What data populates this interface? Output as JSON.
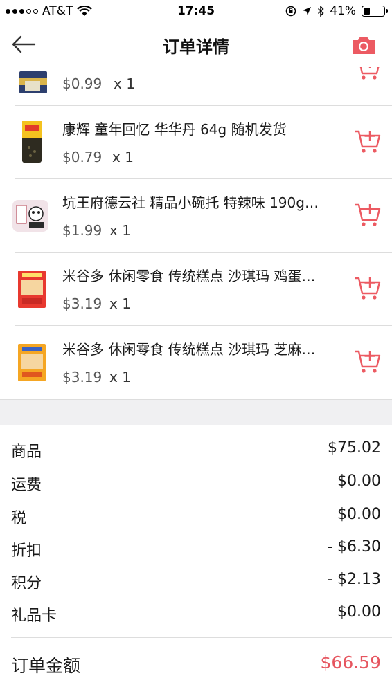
{
  "status_bar": {
    "carrier": "AT&T",
    "time": "17:45",
    "battery": "41%",
    "battery_level": 0.41
  },
  "nav": {
    "title": "订单详情",
    "back_icon": "arrow-left-icon",
    "camera_icon": "camera-icon"
  },
  "items": [
    {
      "name": "",
      "price": "$0.99",
      "qty": "x 1"
    },
    {
      "name": "康辉 童年回忆 华华丹 64g 随机发货",
      "price": "$0.79",
      "qty": "x 1"
    },
    {
      "name": "坑王府德云社 精品小碗托 特辣味 190g…",
      "price": "$1.99",
      "qty": "x 1"
    },
    {
      "name": "米谷多 休闲零食  传统糕点 沙琪玛 鸡蛋…",
      "price": "$3.19",
      "qty": "x 1"
    },
    {
      "name": "米谷多 休闲零食  传统糕点 沙琪玛 芝麻…",
      "price": "$3.19",
      "qty": "x 1"
    }
  ],
  "summary": {
    "subtotal_label": "商品",
    "subtotal_value": "$75.02",
    "shipping_label": "运费",
    "shipping_value": "$0.00",
    "tax_label": "税",
    "tax_value": "$0.00",
    "discount_label": "折扣",
    "discount_value": "- $6.30",
    "points_label": "积分",
    "points_value": "- $2.13",
    "giftcard_label": "礼品卡",
    "giftcard_value": "$0.00",
    "total_label": "订单金额",
    "total_value": "$66.59"
  },
  "colors": {
    "accent": "#e6555f",
    "divider": "#dddddd",
    "band": "#f0f0f2"
  }
}
